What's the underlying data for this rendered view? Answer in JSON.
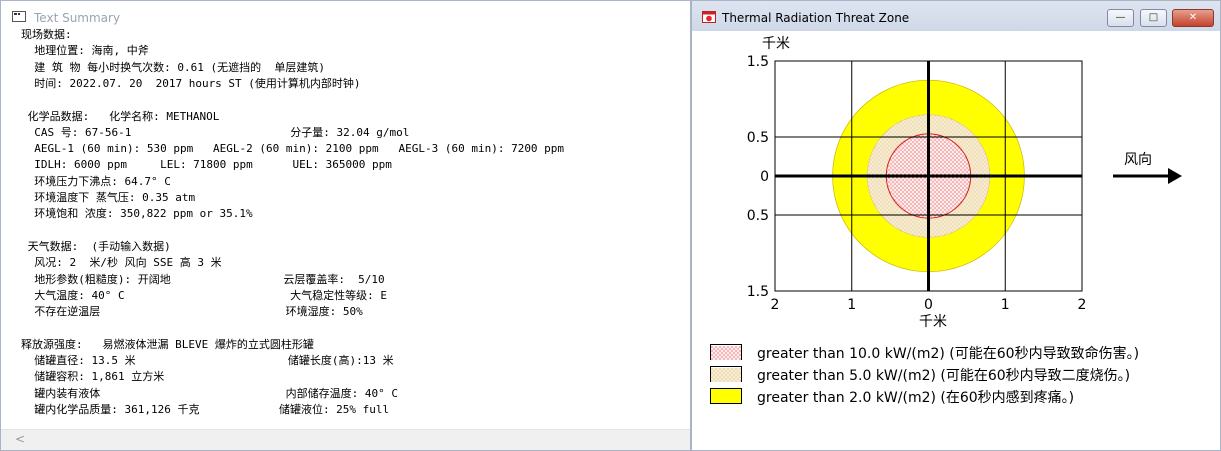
{
  "text_window": {
    "title": "Text Summary",
    "lines": [
      "现场数据:",
      "  地理位置: 海南, 中斧",
      "  建 筑 物 每小时换气次数: 0.61 (无遮挡的  单层建筑)",
      "  时间: 2022.07. 20  2017 hours ST (使用计算机内部时钟)",
      "",
      " 化学品数据:   化学名称: METHANOL",
      "  CAS 号: 67-56-1                        分子量: 32.04 g/mol",
      "  AEGL-1 (60 min): 530 ppm   AEGL-2 (60 min): 2100 ppm   AEGL-3 (60 min): 7200 ppm",
      "  IDLH: 6000 ppm     LEL: 71800 ppm      UEL: 365000 ppm",
      "  环境压力下沸点: 64.7° C",
      "  环境温度下 蒸气压: 0.35 atm",
      "  环境饱和 浓度: 350,822 ppm or 35.1%",
      "",
      " 天气数据:  (手动输入数据)",
      "  风况: 2  米/秒 风向 SSE 高 3 米",
      "  地形参数(粗糙度): 开阔地                 云层覆盖率:  5/10",
      "  大气温度: 40° C                         大气稳定性等级: E",
      "  不存在逆温层                            环境湿度: 50%",
      "",
      "释放源强度:   易燃液体泄漏 BLEVE 爆炸的立式圆柱形罐",
      "  储罐直径: 13.5 米                       储罐长度(高):13 米",
      "  储罐容积: 1,861 立方米",
      "  罐内装有液体                            内部储存温度: 40° C",
      "  罐内化学品质量: 361,126 千克            储罐液位: 25% full"
    ],
    "scroll_left_arrow": "<"
  },
  "threat_window": {
    "title": "Thermal Radiation Threat Zone",
    "buttons": {
      "minimize": "—",
      "maximize": "□",
      "close": "✕"
    },
    "y_unit": "千米",
    "x_unit": "千米",
    "y_ticks": [
      "1.5",
      "0.5",
      "0",
      "0.5",
      "1.5"
    ],
    "x_ticks": [
      "2",
      "1",
      "0",
      "1",
      "2"
    ],
    "wind_label": "风向",
    "legend": [
      {
        "text": "greater than 10.0 kW/(m2) (可能在60秒内导致致命伤害。)",
        "color": "#e23b2e"
      },
      {
        "text": "greater than 5.0 kW/(m2) (可能在60秒内导致二度烧伤。)",
        "color": "#f3dfb3"
      },
      {
        "text": "greater than 2.0 kW/(m2) (在60秒内感到疼痛。)",
        "color": "#ffff00"
      }
    ]
  },
  "chart_data": {
    "type": "threat-zone",
    "x_unit": "千米",
    "y_unit": "千米",
    "xlim": [
      -2,
      2
    ],
    "ylim": [
      -1.5,
      1.5
    ],
    "zones": [
      {
        "label": "greater than 2.0 kW/(m2)",
        "radius": 1.25,
        "color": "#ffff00"
      },
      {
        "label": "greater than 5.0 kW/(m2)",
        "radius": 0.8,
        "color": "#f3dfb3"
      },
      {
        "label": "greater than 10.0 kW/(m2)",
        "radius": 0.55,
        "color": "#ffe6e6"
      }
    ]
  }
}
